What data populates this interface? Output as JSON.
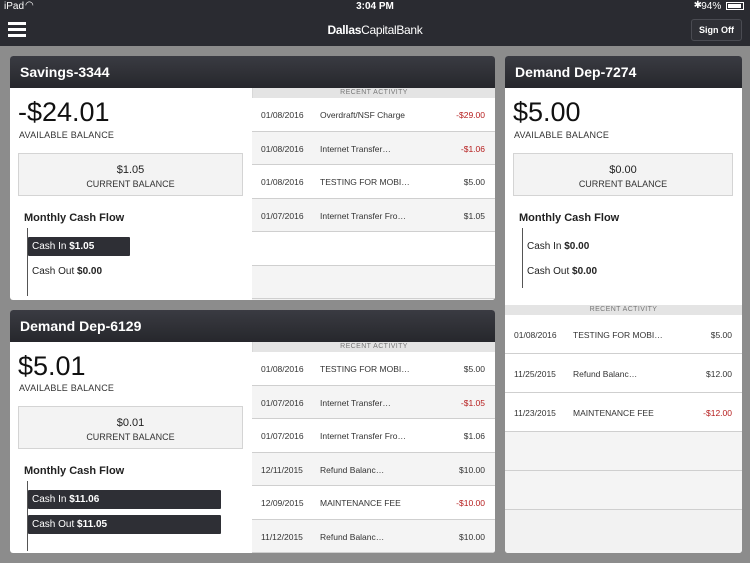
{
  "status": {
    "device": "iPad",
    "time": "3:04 PM",
    "battery": "94%"
  },
  "nav": {
    "brand_bold": "Dallas",
    "brand_rest": "CapitalBank",
    "sign_off": "Sign Off"
  },
  "labels": {
    "available_balance": "AVAILABLE BALANCE",
    "current_balance": "CURRENT BALANCE",
    "monthly_cash_flow": "Monthly Cash Flow",
    "recent_activity": "RECENT ACTIVITY",
    "cash_in": "Cash In",
    "cash_out": "Cash Out"
  },
  "accounts": [
    {
      "name": "Savings-3344",
      "available": "-$24.01",
      "current": "$1.05",
      "cash_in": "$1.05",
      "cash_out": "$0.00",
      "activity": [
        {
          "date": "01/08/2016",
          "desc": "Overdraft/NSF Charge",
          "amount": "-$29.00",
          "negative": true
        },
        {
          "date": "01/08/2016",
          "desc": "Internet Transfer…",
          "amount": "-$1.06",
          "negative": true
        },
        {
          "date": "01/08/2016",
          "desc": "TESTING FOR MOBI…",
          "amount": "$5.00",
          "negative": false
        },
        {
          "date": "01/07/2016",
          "desc": "Internet Transfer Fro…",
          "amount": "$1.05",
          "negative": false
        }
      ]
    },
    {
      "name": "Demand Dep-6129",
      "available": "$5.01",
      "current": "$0.01",
      "cash_in": "$11.06",
      "cash_out": "$11.05",
      "activity": [
        {
          "date": "01/08/2016",
          "desc": "TESTING FOR MOBI…",
          "amount": "$5.00",
          "negative": false
        },
        {
          "date": "01/07/2016",
          "desc": "Internet Transfer…",
          "amount": "-$1.05",
          "negative": true
        },
        {
          "date": "01/07/2016",
          "desc": "Internet Transfer Fro…",
          "amount": "$1.06",
          "negative": false
        },
        {
          "date": "12/11/2015",
          "desc": "Refund Balanc…",
          "amount": "$10.00",
          "negative": false
        },
        {
          "date": "12/09/2015",
          "desc": "MAINTENANCE FEE",
          "amount": "-$10.00",
          "negative": true
        },
        {
          "date": "11/12/2015",
          "desc": "Refund Balanc…",
          "amount": "$10.00",
          "negative": false
        }
      ]
    },
    {
      "name": "Demand Dep-7274",
      "available": "$5.00",
      "current": "$0.00",
      "cash_in": "$0.00",
      "cash_out": "$0.00",
      "activity": [
        {
          "date": "01/08/2016",
          "desc": "TESTING FOR MOBI…",
          "amount": "$5.00",
          "negative": false
        },
        {
          "date": "11/25/2015",
          "desc": "Refund Balanc…",
          "amount": "$12.00",
          "negative": false
        },
        {
          "date": "11/23/2015",
          "desc": "MAINTENANCE FEE",
          "amount": "-$12.00",
          "negative": true
        }
      ]
    }
  ]
}
